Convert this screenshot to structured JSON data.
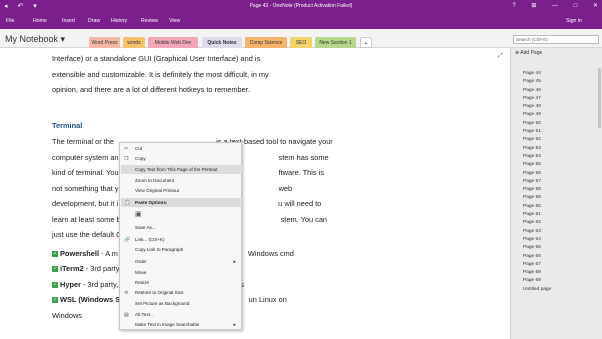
{
  "title": "Page 43 - OneNote (Product Activation Failed)",
  "title_left": "◂ ↶ ▾",
  "title_right": "? ⊞ — □ ✕",
  "menu": [
    "File",
    "Home",
    "Insert",
    "Draw",
    "History",
    "Review",
    "View"
  ],
  "signin": "Sign in",
  "notebook": "My Notebook ▾",
  "tabs": [
    "Word Press",
    "words",
    "Mobile Web Dev",
    "Quick Notes",
    "Comp Science",
    "SEO",
    "New Section 1",
    "+"
  ],
  "search_placeholder": "Search (Ctrl+E)",
  "doc": {
    "l1": "Interface) or a standalone GUI (Graphical User Interface) and is",
    "l2": "extensible and customizable.  It is definitely the most difficult, in my",
    "l3": "opinion, and there are a lot of different hotkeys to remember.",
    "heading": "Terminal",
    "t1a": "The terminal or the ",
    "t1b": "is a text-based tool to navigate your",
    "t2a": "computer system an",
    "t2b": "stem has some",
    "t3a": "kind of terminal. You",
    "t3b": "ftware. This is",
    "t4a": "not something that y",
    "t4b": "web",
    "t5a": "development, but it i",
    "t5b": "u will need to",
    "t6a": "learn at least some b",
    "t6b": "stem. You can",
    "t7a": "just use the default C",
    "b1a": "Powershell",
    "b1b": " - A m",
    "b1c": "Windows cmd",
    "b2a": "iTerm2",
    "b2b": " - 3rd party",
    "b3a": "Hyper",
    "b3b": " - 3rd party,",
    "b3c": "s",
    "b4a": "WSL (Windows Su",
    "b4b": "un Linux on",
    "b5": "Windows"
  },
  "add_page": "⊕ Add Page",
  "pages": [
    "Page 44",
    "Page 45",
    "Page 46",
    "Page 47",
    "Page 48",
    "Page 49",
    "Page 50",
    "Page 51",
    "Page 52",
    "Page 53",
    "Page 54",
    "Page 55",
    "Page 56",
    "Page 57",
    "Page 58",
    "Page 59",
    "Page 60",
    "Page 61",
    "Page 62",
    "Page 63",
    "Page 64",
    "Page 65",
    "Page 66",
    "Page 67",
    "Page 68",
    "Page 69",
    "Untitled page"
  ],
  "ctx": {
    "cut": "Cut",
    "copy": "Copy",
    "copytext": "Copy Text from This Page of the Printout",
    "zoom": "Zoom to Document",
    "view": "View Original Printout",
    "paste": "Paste Options:",
    "saveas": "Save As...",
    "link": "Link...  (Ctrl+K)",
    "copylink": "Copy Link to Paragraph",
    "order": "Order",
    "move": "Move",
    "resize": "Resize",
    "restore": "Restore to Original Size",
    "setbg": "Set Picture as Background",
    "alt": "Alt Text...",
    "make": "Make Text in Image Searchable"
  }
}
